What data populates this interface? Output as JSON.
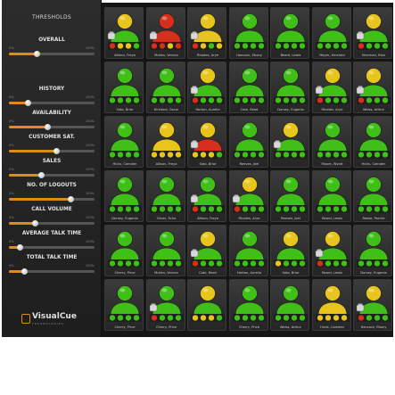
{
  "sidebar": {
    "title": "THRESHOLDS",
    "thresholds": [
      {
        "label": "OVERALL",
        "min": "0%",
        "max": "100%",
        "value": 0.32
      },
      {
        "label": "HISTORY",
        "min": "0%",
        "max": "100%",
        "value": 0.22
      },
      {
        "label": "AVAILABILITY",
        "min": "0%",
        "max": "100%",
        "value": 0.45
      },
      {
        "label": "CUSTOMER SAT.",
        "min": "0%",
        "max": "100%",
        "value": 0.55
      },
      {
        "label": "SALES",
        "min": "0%",
        "max": "100%",
        "value": 0.38
      },
      {
        "label": "NO. OF LOGOUTS",
        "min": "0%",
        "max": "100%",
        "value": 0.72
      },
      {
        "label": "CALL VOLUME",
        "min": "0%",
        "max": "100%",
        "value": 0.3
      },
      {
        "label": "AVERAGE TALK TIME",
        "min": "0%",
        "max": "100%",
        "value": 0.12
      },
      {
        "label": "TOTAL TALK TIME",
        "min": "0%",
        "max": "100%",
        "value": 0.18
      }
    ]
  },
  "logo": {
    "name": "VisualCue",
    "tagline": "TECHNOLOGIES"
  },
  "colors": {
    "green": "#3fbf17",
    "yellow": "#e8c51c",
    "red": "#d6301c",
    "accent": "#e08a1a"
  },
  "agents": [
    {
      "name": "Allison, Freya",
      "head": "yellow",
      "body": "green",
      "icons": [
        "red",
        "yellow",
        "yellow",
        "green"
      ],
      "hat": "phone"
    },
    {
      "name": "Mullen, Vernon",
      "head": "red",
      "body": "red",
      "icons": [
        "red",
        "red",
        "yellow",
        "red"
      ],
      "hat": "phone"
    },
    {
      "name": "Rhodes, Arye",
      "head": "yellow",
      "body": "yellow",
      "icons": [
        "red",
        "yellow",
        "green",
        "yellow"
      ],
      "hat": "phone"
    },
    {
      "name": "Hancock, Ebony",
      "head": "green",
      "body": "green",
      "icons": [
        "green",
        "green",
        "green",
        "green"
      ],
      "hat": "none"
    },
    {
      "name": "Beard, Lewis",
      "head": "green",
      "body": "green",
      "icons": [
        "green",
        "green",
        "green",
        "green"
      ],
      "hat": "none"
    },
    {
      "name": "Meyer, Emerald",
      "head": "green",
      "body": "green",
      "icons": [
        "green",
        "green",
        "green",
        "green"
      ],
      "hat": "none"
    },
    {
      "name": "Sherman, Blair",
      "head": "yellow",
      "body": "green",
      "icons": [
        "red",
        "green",
        "green",
        "green"
      ],
      "hat": "phone"
    },
    {
      "name": "Soto, Briar",
      "head": "green",
      "body": "green",
      "icons": [
        "green",
        "green",
        "green",
        "green"
      ],
      "hat": "none"
    },
    {
      "name": "Kirkland, Oscar",
      "head": "green",
      "body": "green",
      "icons": [
        "green",
        "green",
        "green",
        "green"
      ],
      "hat": "none"
    },
    {
      "name": "Horton, Aurelia",
      "head": "yellow",
      "body": "green",
      "icons": [
        "red",
        "green",
        "green",
        "green"
      ],
      "hat": "phone"
    },
    {
      "name": "Cote, Reed",
      "head": "green",
      "body": "green",
      "icons": [
        "green",
        "green",
        "green",
        "green"
      ],
      "hat": "none"
    },
    {
      "name": "Dorsey, Eugenia",
      "head": "green",
      "body": "green",
      "icons": [
        "green",
        "green",
        "green",
        "green"
      ],
      "hat": "none"
    },
    {
      "name": "Rhodes, Arye",
      "head": "yellow",
      "body": "green",
      "icons": [
        "red",
        "green",
        "green",
        "green"
      ],
      "hat": "phone"
    },
    {
      "name": "Weiss, Arthur",
      "head": "yellow",
      "body": "green",
      "icons": [
        "red",
        "green",
        "green",
        "green"
      ],
      "hat": "phone"
    },
    {
      "name": "Hicks, Camden",
      "head": "green",
      "body": "green",
      "icons": [
        "green",
        "green",
        "green",
        "green"
      ],
      "hat": "none"
    },
    {
      "name": "Allison, Freya",
      "head": "yellow",
      "body": "yellow",
      "icons": [
        "yellow",
        "yellow",
        "yellow",
        "yellow"
      ],
      "hat": "none"
    },
    {
      "name": "Soto, Briar",
      "head": "yellow",
      "body": "red",
      "icons": [
        "yellow",
        "yellow",
        "yellow",
        "green"
      ],
      "hat": "phone"
    },
    {
      "name": "Reeves, Joel",
      "head": "green",
      "body": "green",
      "icons": [
        "green",
        "green",
        "green",
        "green"
      ],
      "hat": "none"
    },
    {
      "name": "",
      "head": "yellow",
      "body": "green",
      "icons": [
        "green",
        "green",
        "green",
        "green"
      ],
      "hat": "phone"
    },
    {
      "name": "Moore, Wyatt",
      "head": "green",
      "body": "green",
      "icons": [
        "green",
        "green",
        "green",
        "green"
      ],
      "hat": "none"
    },
    {
      "name": "Hicks, Camden",
      "head": "green",
      "body": "green",
      "icons": [
        "green",
        "green",
        "green",
        "green"
      ],
      "hat": "none"
    },
    {
      "name": "Dorsey, Eugenia",
      "head": "green",
      "body": "green",
      "icons": [
        "green",
        "green",
        "green",
        "green"
      ],
      "hat": "none"
    },
    {
      "name": "Oliver, Echo",
      "head": "green",
      "body": "green",
      "icons": [
        "green",
        "green",
        "green",
        "green"
      ],
      "hat": "none"
    },
    {
      "name": "Allison, Freya",
      "head": "green",
      "body": "green",
      "icons": [
        "red",
        "green",
        "green",
        "green"
      ],
      "hat": "phone"
    },
    {
      "name": "Rhodes, Arye",
      "head": "yellow",
      "body": "green",
      "icons": [
        "red",
        "green",
        "green",
        "green"
      ],
      "hat": "phone"
    },
    {
      "name": "Reeves, Joel",
      "head": "green",
      "body": "green",
      "icons": [
        "green",
        "green",
        "green",
        "green"
      ],
      "hat": "none"
    },
    {
      "name": "Beard, Lewis",
      "head": "green",
      "body": "green",
      "icons": [
        "green",
        "green",
        "green",
        "green"
      ],
      "hat": "none"
    },
    {
      "name": "Reese, Porcile",
      "head": "green",
      "body": "green",
      "icons": [
        "green",
        "green",
        "green",
        "green"
      ],
      "hat": "none"
    },
    {
      "name": "Cherry, Price",
      "head": "green",
      "body": "green",
      "icons": [
        "green",
        "green",
        "green",
        "green"
      ],
      "hat": "none"
    },
    {
      "name": "Mullen, Vernon",
      "head": "green",
      "body": "green",
      "icons": [
        "green",
        "green",
        "green",
        "green"
      ],
      "hat": "none"
    },
    {
      "name": "Cote, Reed",
      "head": "yellow",
      "body": "green",
      "icons": [
        "red",
        "green",
        "green",
        "green"
      ],
      "hat": "phone"
    },
    {
      "name": "Horton, Aurelia",
      "head": "green",
      "body": "green",
      "icons": [
        "green",
        "green",
        "green",
        "green"
      ],
      "hat": "none"
    },
    {
      "name": "Soto, Briar",
      "head": "yellow",
      "body": "green",
      "icons": [
        "yellow",
        "green",
        "green",
        "green"
      ],
      "hat": "none"
    },
    {
      "name": "Beard, Lewis",
      "head": "yellow",
      "body": "green",
      "icons": [
        "red",
        "green",
        "green",
        "green"
      ],
      "hat": "phone"
    },
    {
      "name": "Dorsey, Eugenia",
      "head": "green",
      "body": "green",
      "icons": [
        "green",
        "green",
        "green",
        "green"
      ],
      "hat": "none"
    },
    {
      "name": "Cherry, Price",
      "head": "green",
      "body": "green",
      "icons": [
        "green",
        "green",
        "green",
        "green"
      ],
      "hat": "none"
    },
    {
      "name": "Cherry, Price",
      "head": "green",
      "body": "green",
      "icons": [
        "red",
        "green",
        "green",
        "green"
      ],
      "hat": "phone"
    },
    {
      "name": "",
      "head": "yellow",
      "body": "green",
      "icons": [
        "yellow",
        "yellow",
        "yellow",
        "green"
      ],
      "hat": "none"
    },
    {
      "name": "Cherry, Price",
      "head": "green",
      "body": "green",
      "icons": [
        "green",
        "green",
        "green",
        "green"
      ],
      "hat": "none"
    },
    {
      "name": "Weiss, Arthur",
      "head": "green",
      "body": "green",
      "icons": [
        "green",
        "green",
        "green",
        "green"
      ],
      "hat": "none"
    },
    {
      "name": "Hicks, Camden",
      "head": "yellow",
      "body": "yellow",
      "icons": [
        "yellow",
        "yellow",
        "yellow",
        "yellow"
      ],
      "hat": "none"
    },
    {
      "name": "Hancock, Ebony",
      "head": "yellow",
      "body": "green",
      "icons": [
        "red",
        "green",
        "green",
        "green"
      ],
      "hat": "phone"
    }
  ]
}
